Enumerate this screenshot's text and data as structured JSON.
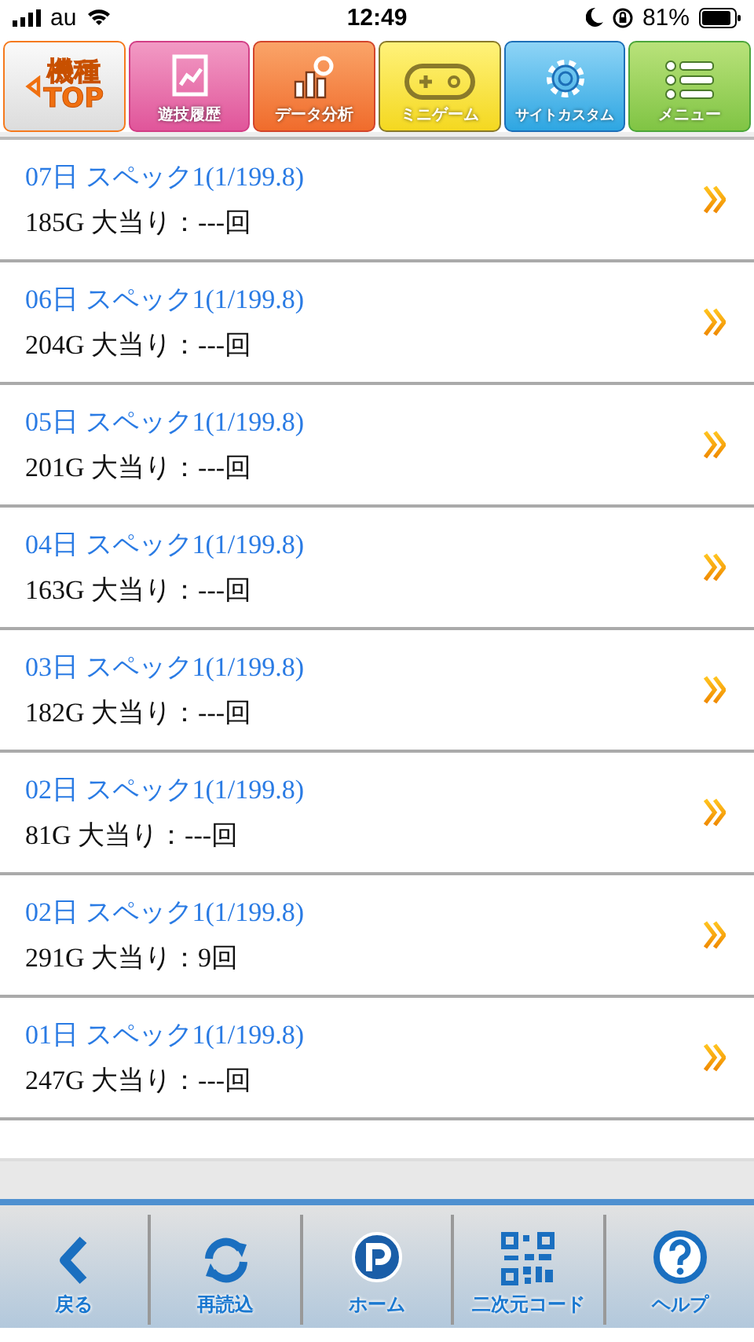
{
  "status_bar": {
    "carrier": "au",
    "time": "12:49",
    "battery_text": "81%"
  },
  "nav_tabs": [
    {
      "kind": "back",
      "label_lines": [
        "機種",
        "TOP"
      ]
    },
    {
      "kind": "history",
      "label_lines": [
        "遊技履歴"
      ]
    },
    {
      "kind": "analysis",
      "label_lines": [
        "データ分析"
      ]
    },
    {
      "kind": "game",
      "label_lines": [
        "ミニゲーム"
      ]
    },
    {
      "kind": "custom",
      "label_lines": [
        "サイトカスタム"
      ]
    },
    {
      "kind": "menu",
      "label_lines": [
        "メニュー"
      ]
    }
  ],
  "history_rows": [
    {
      "title": "07日 スペック1(1/199.8)",
      "detail": "185G 大当り：---回"
    },
    {
      "title": "06日 スペック1(1/199.8)",
      "detail": "204G 大当り：---回"
    },
    {
      "title": "05日 スペック1(1/199.8)",
      "detail": "201G 大当り：---回"
    },
    {
      "title": "04日 スペック1(1/199.8)",
      "detail": "163G 大当り：---回"
    },
    {
      "title": "03日 スペック1(1/199.8)",
      "detail": "182G 大当り：---回"
    },
    {
      "title": "02日 スペック1(1/199.8)",
      "detail": "81G 大当り：---回"
    },
    {
      "title": "02日 スペック1(1/199.8)",
      "detail": "291G 大当り：9回"
    },
    {
      "title": "01日 スペック1(1/199.8)",
      "detail": "247G 大当り：---回"
    }
  ],
  "toolbar": [
    {
      "kind": "back",
      "label": "戻る"
    },
    {
      "kind": "reload",
      "label": "再読込"
    },
    {
      "kind": "home",
      "label": "ホーム"
    },
    {
      "kind": "qr",
      "label": "二次元コード"
    },
    {
      "kind": "help",
      "label": "ヘルプ"
    }
  ]
}
